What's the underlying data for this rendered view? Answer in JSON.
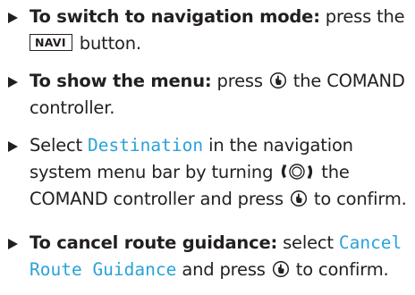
{
  "steps": [
    {
      "lead": "To switch to navigation mode:",
      "text_a": " press the",
      "key_label": "NAVI",
      "text_b": " button."
    },
    {
      "lead": "To show the menu:",
      "text_a": " press ",
      "text_b": " the COMAND controller."
    },
    {
      "text_a": "Select ",
      "menu_item": "Destination",
      "text_b": " in the navigation system menu bar by turning ",
      "text_c": " the COMAND controller and press ",
      "text_d": " to confirm."
    },
    {
      "lead": "To cancel route guidance:",
      "text_a": " select ",
      "menu_item": "Cancel Route Guidance",
      "text_b": " and press ",
      "text_c": " to confirm."
    }
  ],
  "colors": {
    "text": "#231f20",
    "menu_item": "#29a3d8"
  },
  "icons": {
    "press": "controller-press-icon",
    "turn": "controller-turn-icon"
  }
}
